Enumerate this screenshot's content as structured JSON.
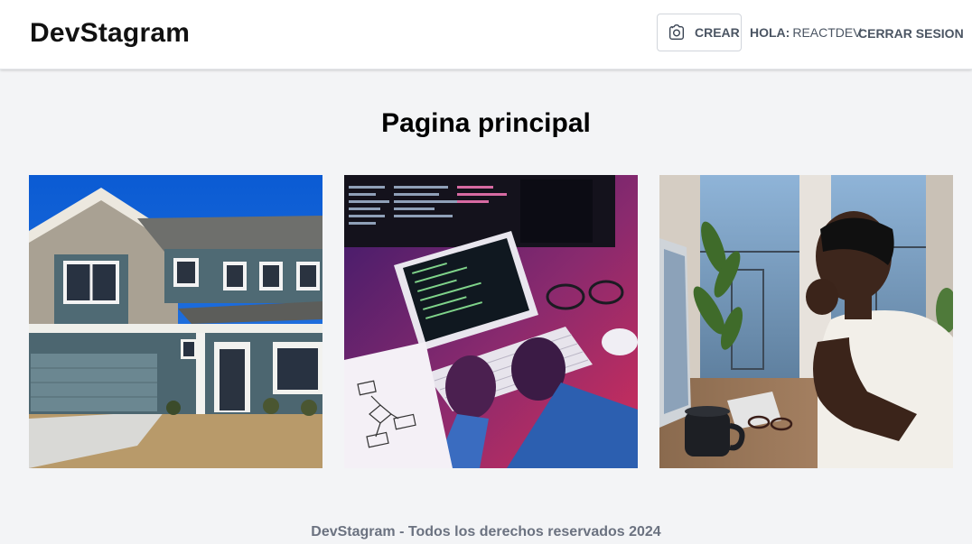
{
  "header": {
    "brand": "DevStagram",
    "create_label": "CREAR",
    "greeting_label": "HOLA:",
    "username": "REACTDEV",
    "logout_label": "CERRAR SESION"
  },
  "main": {
    "title": "Pagina principal",
    "posts": [
      {
        "subject": "house-photo"
      },
      {
        "subject": "coding-tablet-photo"
      },
      {
        "subject": "developer-at-desk-photo"
      }
    ]
  },
  "footer": {
    "text": "DevStagram - Todos los derechos reservados 2024"
  },
  "colors": {
    "background": "#f3f4f6",
    "header_bg": "#ffffff",
    "muted_text": "#4b5563",
    "footer_text": "#6b7280"
  }
}
